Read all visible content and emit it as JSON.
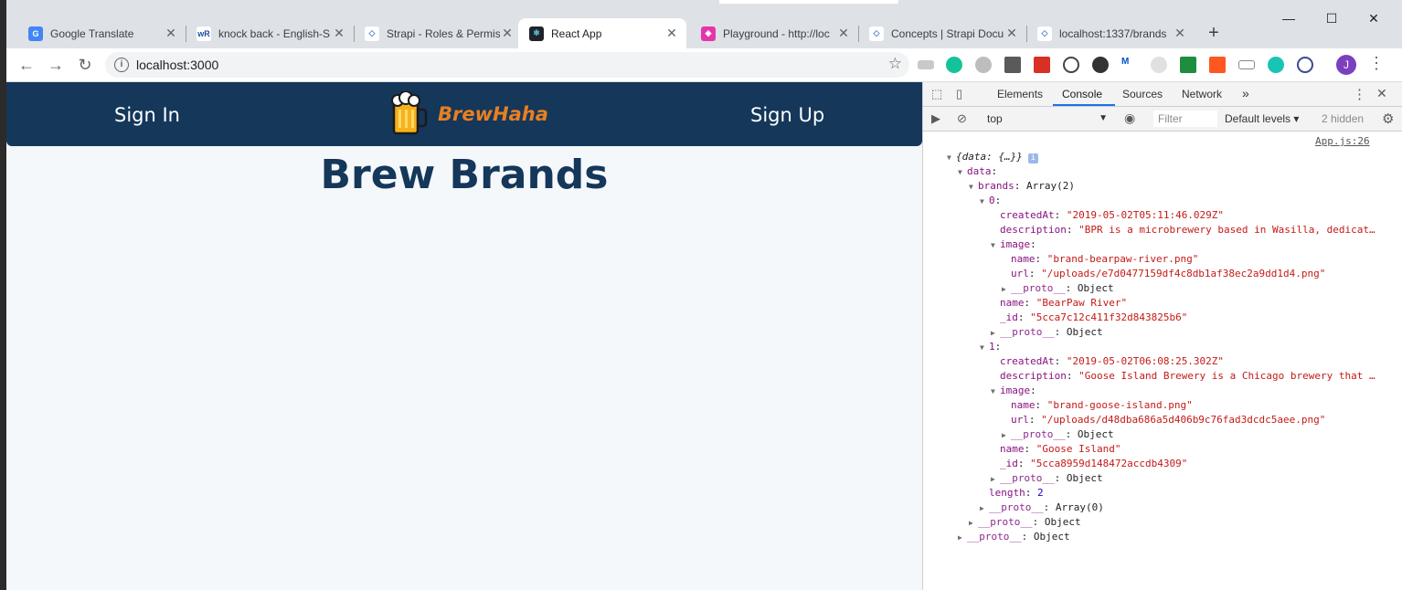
{
  "browser": {
    "tabs": [
      {
        "title": "Google Translate",
        "icon": "google-translate-icon",
        "color": "#4285f4",
        "glyph": "G"
      },
      {
        "title": "knock back - English-S",
        "icon": "wordreference-icon",
        "color": "#ffffff",
        "glyph": "wR"
      },
      {
        "title": "Strapi - Roles & Permis",
        "icon": "strapi-icon",
        "color": "#ffffff",
        "glyph": "◇"
      },
      {
        "title": "React App",
        "icon": "react-icon",
        "color": "#20232a",
        "glyph": "⚛"
      },
      {
        "title": "Playground - http://loc",
        "icon": "graphql-icon",
        "color": "#e535ab",
        "glyph": "◈"
      },
      {
        "title": "Concepts | Strapi Docu",
        "icon": "strapi-docs-icon",
        "color": "#ffffff",
        "glyph": "◇"
      },
      {
        "title": "localhost:1337/brands",
        "icon": "globe-icon",
        "color": "#ffffff",
        "glyph": "◇"
      }
    ],
    "active_tab": 3,
    "url": "localhost:3000",
    "profile_initial": "J",
    "window_controls": {
      "minimize": "—",
      "maximize": "☐",
      "close": "✕"
    }
  },
  "app": {
    "nav": {
      "sign_in": "Sign In",
      "brand": "BrewHaha",
      "sign_up": "Sign Up"
    },
    "title": "Brew Brands",
    "brand_color": "#e87f21",
    "nav_color": "#14375a"
  },
  "devtools": {
    "tabs": [
      "Elements",
      "Console",
      "Sources",
      "Network"
    ],
    "active": "Console",
    "more": "»",
    "context": "top",
    "filter_placeholder": "Filter",
    "levels": "Default levels ▾",
    "hidden": "2 hidden",
    "source_link": "App.js:26",
    "console_lines": [
      {
        "indent": 0,
        "tri": "▼",
        "key": "",
        "value": "{data: {…}}",
        "italic": true,
        "badge": "i"
      },
      {
        "indent": 1,
        "tri": "▼",
        "key": "data",
        "value": ""
      },
      {
        "indent": 2,
        "tri": "▼",
        "key": "brands",
        "value": "Array(2)",
        "vclass": "obj"
      },
      {
        "indent": 3,
        "tri": "▼",
        "key": "0",
        "value": ""
      },
      {
        "indent": 4,
        "tri": "",
        "key": "createdAt",
        "value": "\"2019-05-02T05:11:46.029Z\"",
        "vclass": "s"
      },
      {
        "indent": 4,
        "tri": "",
        "key": "description",
        "value": "\"BPR is a microbrewery based in Wasilla, dedicat…",
        "vclass": "s"
      },
      {
        "indent": 4,
        "tri": "▼",
        "key": "image",
        "value": ""
      },
      {
        "indent": 5,
        "tri": "",
        "key": "name",
        "value": "\"brand-bearpaw-river.png\"",
        "vclass": "s"
      },
      {
        "indent": 5,
        "tri": "",
        "key": "url",
        "value": "\"/uploads/e7d0477159df4c8db1af38ec2a9dd1d4.png\"",
        "vclass": "s"
      },
      {
        "indent": 5,
        "tri": "▶",
        "key": "__proto__",
        "value": "Object",
        "vclass": "obj",
        "proto": true
      },
      {
        "indent": 4,
        "tri": "",
        "key": "name",
        "value": "\"BearPaw River\"",
        "vclass": "s"
      },
      {
        "indent": 4,
        "tri": "",
        "key": "_id",
        "value": "\"5cca7c12c411f32d843825b6\"",
        "vclass": "s"
      },
      {
        "indent": 4,
        "tri": "▶",
        "key": "__proto__",
        "value": "Object",
        "vclass": "obj",
        "proto": true
      },
      {
        "indent": 3,
        "tri": "▼",
        "key": "1",
        "value": ""
      },
      {
        "indent": 4,
        "tri": "",
        "key": "createdAt",
        "value": "\"2019-05-02T06:08:25.302Z\"",
        "vclass": "s"
      },
      {
        "indent": 4,
        "tri": "",
        "key": "description",
        "value": "\"Goose Island Brewery is a Chicago brewery that …",
        "vclass": "s"
      },
      {
        "indent": 4,
        "tri": "▼",
        "key": "image",
        "value": ""
      },
      {
        "indent": 5,
        "tri": "",
        "key": "name",
        "value": "\"brand-goose-island.png\"",
        "vclass": "s"
      },
      {
        "indent": 5,
        "tri": "",
        "key": "url",
        "value": "\"/uploads/d48dba686a5d406b9c76fad3dcdc5aee.png\"",
        "vclass": "s"
      },
      {
        "indent": 5,
        "tri": "▶",
        "key": "__proto__",
        "value": "Object",
        "vclass": "obj",
        "proto": true
      },
      {
        "indent": 4,
        "tri": "",
        "key": "name",
        "value": "\"Goose Island\"",
        "vclass": "s"
      },
      {
        "indent": 4,
        "tri": "",
        "key": "_id",
        "value": "\"5cca8959d148472accdb4309\"",
        "vclass": "s"
      },
      {
        "indent": 4,
        "tri": "▶",
        "key": "__proto__",
        "value": "Object",
        "vclass": "obj",
        "proto": true
      },
      {
        "indent": 3,
        "tri": "",
        "key": "length",
        "value": "2",
        "vclass": "n"
      },
      {
        "indent": 3,
        "tri": "▶",
        "key": "__proto__",
        "value": "Array(0)",
        "vclass": "obj",
        "proto": true
      },
      {
        "indent": 2,
        "tri": "▶",
        "key": "__proto__",
        "value": "Object",
        "vclass": "obj",
        "proto": true
      },
      {
        "indent": 1,
        "tri": "▶",
        "key": "__proto__",
        "value": "Object",
        "vclass": "obj",
        "proto": true
      }
    ],
    "prompt": "›"
  }
}
